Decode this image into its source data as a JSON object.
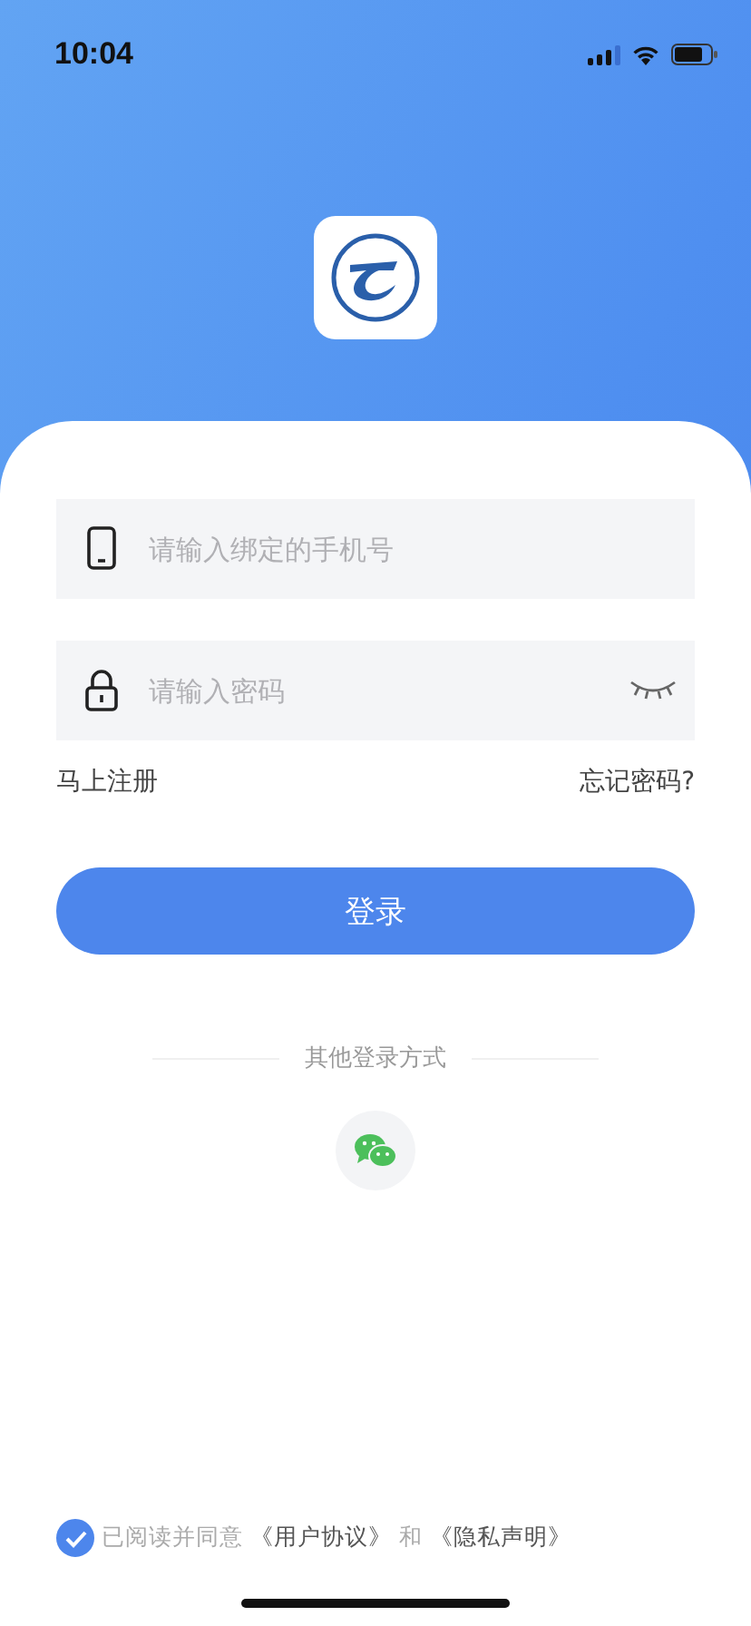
{
  "status_bar": {
    "time": "10:04"
  },
  "phone_field": {
    "placeholder": "请输入绑定的手机号"
  },
  "password_field": {
    "placeholder": "请输入密码",
    "password_visible": false
  },
  "register_link": "马上注册",
  "forgot_link": "忘记密码?",
  "login_button": "登录",
  "other_login": {
    "label": "其他登录方式"
  },
  "agreement": {
    "checked": true,
    "prefix": "已阅读并同意",
    "terms_link": "《用户协议》",
    "conjunction": "和",
    "privacy_link": "《隐私声明》"
  }
}
